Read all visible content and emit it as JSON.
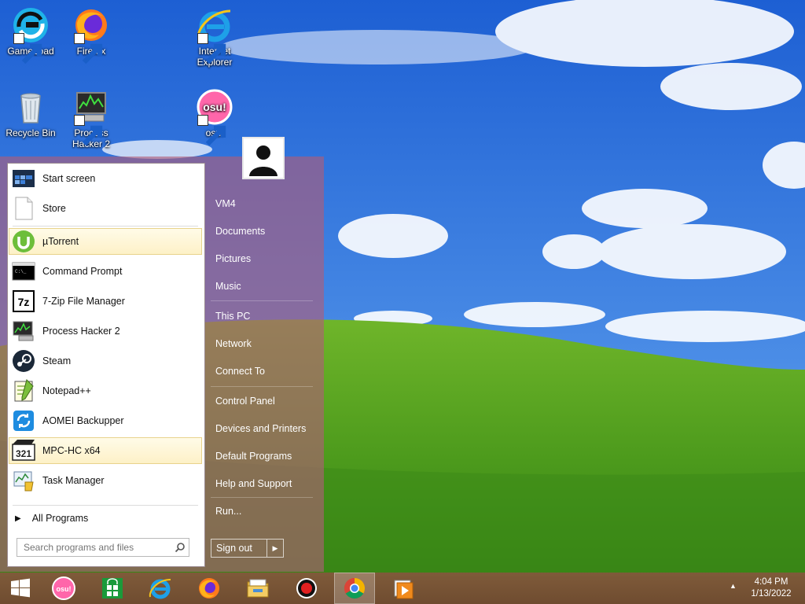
{
  "desktop": {
    "icons": [
      {
        "label": "GameLoad",
        "icon": "gameload-icon"
      },
      {
        "label": "Firefox",
        "icon": "firefox-icon"
      },
      {
        "label": "Internet Explorer",
        "icon": "internet-explorer-icon"
      },
      {
        "label": "Recycle Bin",
        "icon": "recycle-bin-icon"
      },
      {
        "label": "Process Hacker 2",
        "icon": "process-hacker-icon"
      },
      {
        "label": "osu!",
        "icon": "osu-icon"
      }
    ]
  },
  "start_menu": {
    "programs": [
      {
        "label": "Start screen",
        "icon": "start-screen-icon"
      },
      {
        "label": "Store",
        "icon": "store-icon"
      },
      {
        "label": "µTorrent",
        "icon": "utorrent-icon"
      },
      {
        "label": "Command Prompt",
        "icon": "command-prompt-icon"
      },
      {
        "label": "7-Zip File Manager",
        "icon": "7zip-icon"
      },
      {
        "label": "Process Hacker 2",
        "icon": "process-hacker-icon"
      },
      {
        "label": "Steam",
        "icon": "steam-icon"
      },
      {
        "label": "Notepad++",
        "icon": "notepadpp-icon"
      },
      {
        "label": "AOMEI Backupper",
        "icon": "aomei-icon"
      },
      {
        "label": "MPC-HC x64",
        "icon": "mpc-hc-icon"
      },
      {
        "label": "Task Manager",
        "icon": "task-manager-icon"
      }
    ],
    "all_programs": "All Programs",
    "search_placeholder": "Search programs and files",
    "right_items": [
      "VM4",
      "Documents",
      "Pictures",
      "Music",
      "This PC",
      "Network",
      "Connect To",
      "Control Panel",
      "Devices and Printers",
      "Default Programs",
      "Help and Support",
      "Run..."
    ],
    "sign_out": "Sign out"
  },
  "taskbar": {
    "buttons": [
      {
        "name": "start",
        "icon": "windows-logo-icon"
      },
      {
        "name": "osu",
        "icon": "osu-icon"
      },
      {
        "name": "store",
        "icon": "store-icon"
      },
      {
        "name": "internet-explorer",
        "icon": "internet-explorer-icon"
      },
      {
        "name": "firefox",
        "icon": "firefox-icon"
      },
      {
        "name": "file-explorer",
        "icon": "file-explorer-icon"
      },
      {
        "name": "record",
        "icon": "record-icon"
      },
      {
        "name": "chrome",
        "icon": "chrome-icon",
        "active": true
      },
      {
        "name": "media-player",
        "icon": "media-player-icon"
      }
    ],
    "time": "4:04 PM",
    "date": "1/13/2022"
  },
  "colors": {
    "start_menu_bg": "#b05c78",
    "taskbar_bg": "#7f5b3a",
    "highlight_bg": "#fdf1c7"
  }
}
